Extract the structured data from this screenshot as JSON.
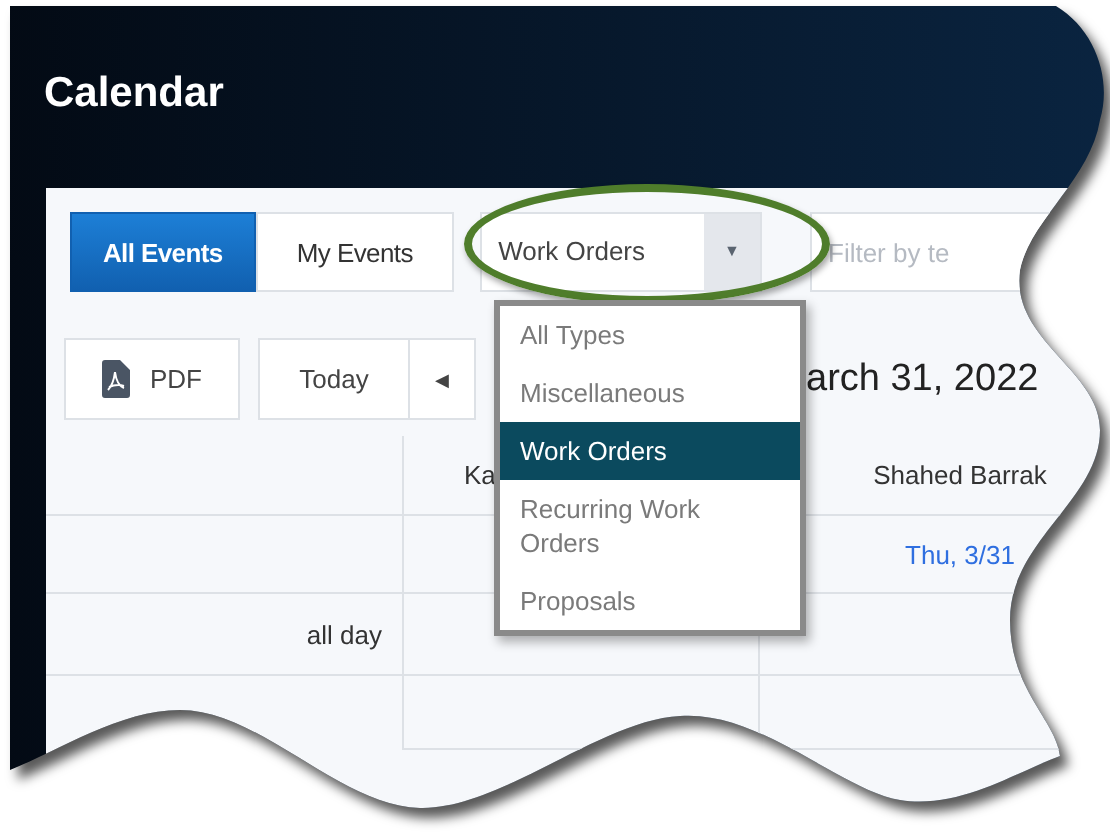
{
  "header": {
    "title": "Calendar"
  },
  "view_tabs": [
    {
      "label": "All Events",
      "selected": true
    },
    {
      "label": "My Events",
      "selected": false
    }
  ],
  "type_filter": {
    "value": "Work Orders",
    "arrow": "▼",
    "highlighted": true,
    "expanded": true,
    "options": [
      {
        "label": "All Types",
        "selected": false
      },
      {
        "label": "Miscellaneous",
        "selected": false
      },
      {
        "label": "Work Orders",
        "selected": true
      },
      {
        "label": "Recurring Work Orders",
        "selected": false
      },
      {
        "label": "Proposals",
        "selected": false
      }
    ]
  },
  "text_filter": {
    "placeholder": "Filter by te"
  },
  "nav": {
    "pdf_label": "PDF",
    "today_label": "Today",
    "prev_arrow": "◀",
    "date_title": "arch 31, 2022"
  },
  "grid": {
    "columns": [
      {
        "name": "Ka"
      },
      {
        "name": "Shahed Barrak",
        "date": "Thu, 3/31"
      }
    ],
    "all_day_label": "all day"
  }
}
